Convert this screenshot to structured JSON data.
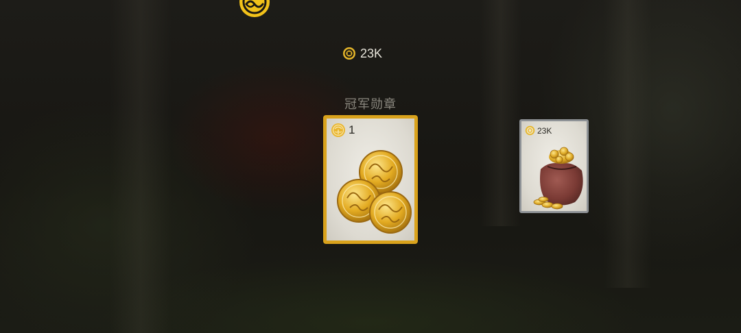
{
  "colors": {
    "gold_accent": "#d9a21c",
    "coin_gold": "#e6b62a",
    "card_border_inactive": "#8e9296",
    "title_gray": "#8a877e"
  },
  "header": {
    "emblem_icon": "gold-swirl-emblem-icon"
  },
  "currency": {
    "icon": "coin-icon",
    "amount": "23K"
  },
  "reward": {
    "title": "冠军勋章"
  },
  "cards": [
    {
      "state": "selected",
      "badge_icon": "medal-emblem-icon",
      "badge_value": "1",
      "art": "gold-medals-image"
    },
    {
      "state": "normal",
      "badge_icon": "coin-icon",
      "badge_value": "23K",
      "art": "coin-bag-image"
    }
  ]
}
